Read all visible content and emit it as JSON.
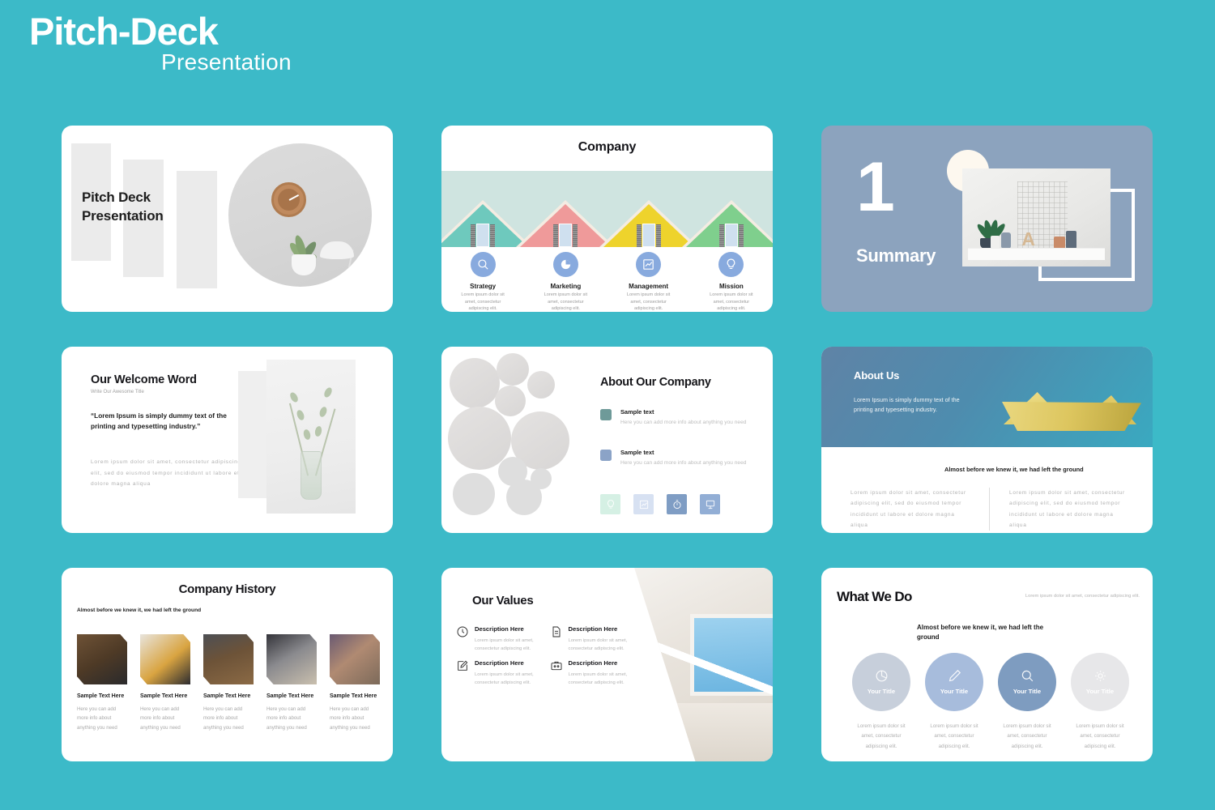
{
  "header": {
    "title": "Pitch-Deck",
    "subtitle": "Presentation"
  },
  "colors": {
    "background_teal": "#3cbac8",
    "slate_blue": "#8ca3be",
    "icon_blue": "#88aade",
    "swatch_teal": "#6e9a99",
    "swatch_blue": "#8ba3c7"
  },
  "slides": {
    "cover": {
      "title_line1": "Pitch Deck",
      "title_line2": "Presentation",
      "photo_alt": "wall-clock-lamp-plant-photo"
    },
    "company": {
      "title": "Company",
      "items": [
        {
          "icon": "search-icon",
          "label": "Strategy",
          "text": "Lorem ipsum dolor sit amet, consectetur adipiscing elit.",
          "roof_color": "#6ec9bd"
        },
        {
          "icon": "pie-chart-icon",
          "label": "Marketing",
          "text": "Lorem ipsum dolor sit amet, consectetur adipiscing elit.",
          "roof_color": "#ef9a9a"
        },
        {
          "icon": "line-chart-icon",
          "label": "Management",
          "text": "Lorem ipsum dolor sit amet, consectetur adipiscing elit.",
          "roof_color": "#eed32c"
        },
        {
          "icon": "lightbulb-icon",
          "label": "Mission",
          "text": "Lorem ipsum dolor sit amet, consectetur adipiscing elit.",
          "roof_color": "#7fcf8d"
        }
      ]
    },
    "summary": {
      "number": "1",
      "label": "Summary",
      "photo_alt": "shelf-decor-plant-grid-photo"
    },
    "welcome": {
      "title": "Our Welcome Word",
      "subtitle": "Write Our Awesome Title",
      "quote": "“Lorem Ipsum is simply dummy text of the printing and typesetting industry.”",
      "body": "Lorem ipsum dolor sit amet, consectetur adipiscing elit, sed do eiusmod tempor incididunt ut labore et dolore magna aliqua",
      "photo_alt": "eucalyptus-vase-photo"
    },
    "about_company": {
      "title": "About Our Company",
      "items": [
        {
          "heading": "Sample text",
          "text": "Here you can add more info about anything you need",
          "swatch": "#6e9a99"
        },
        {
          "heading": "Sample text",
          "text": "Here you can add more info about anything you need",
          "swatch": "#8ba3c7"
        }
      ],
      "tiles": [
        {
          "icon": "lightbulb-icon",
          "color": "#d5f0e4"
        },
        {
          "icon": "line-chart-icon",
          "color": "#d7e1f2"
        },
        {
          "icon": "stopwatch-icon",
          "color": "#7f9dc4"
        },
        {
          "icon": "presentation-icon",
          "color": "#92aed5"
        }
      ]
    },
    "about_us": {
      "title": "About Us",
      "subtitle": "Lorem Ipsum is simply dummy text of the printing and typesetting industry.",
      "kicker": "Almost before we knew it, we had left the ground",
      "columns": [
        "Lorem ipsum dolor sit amet, consectetur adipiscing elit, sed do eiusmod tempor incididunt ut labore et dolore magna aliqua",
        "Lorem ipsum dolor sit amet, consectetur adipiscing elit, sed do eiusmod tempor incididunt ut labore et dolore magna aliqua"
      ],
      "photo_alt": "yellow-origami-paper-boat-photo"
    },
    "history": {
      "title": "Company History",
      "kicker": "Almost before we knew it, we had left the ground",
      "cards": [
        {
          "heading": "Sample Text Here",
          "text": "Here you can add more info about anything you need",
          "photo_alt": "desk-coffee-notebook-photo"
        },
        {
          "heading": "Sample Text Here",
          "text": "Here you can add more info about anything you need",
          "photo_alt": "signing-documents-photo"
        },
        {
          "heading": "Sample Text Here",
          "text": "Here you can add more info about anything you need",
          "photo_alt": "team-meeting-table-photo"
        },
        {
          "heading": "Sample Text Here",
          "text": "Here you can add more info about anything you need",
          "photo_alt": "newspaper-reading-photo"
        },
        {
          "heading": "Sample Text Here",
          "text": "Here you can add more info about anything you need",
          "photo_alt": "hands-building-blocks-photo"
        }
      ]
    },
    "values": {
      "title": "Our Values",
      "items": [
        {
          "icon": "clock-icon",
          "heading": "Description Here",
          "text": "Lorem ipsum dolor sit amet, consectetur adipiscing elit."
        },
        {
          "icon": "document-icon",
          "heading": "Description Here",
          "text": "Lorem ipsum dolor sit amet, consectetur adipiscing elit."
        },
        {
          "icon": "pencil-edit-icon",
          "heading": "Description Here",
          "text": "Lorem ipsum dolor sit amet, consectetur adipiscing elit."
        },
        {
          "icon": "briefcase-icon",
          "heading": "Description Here",
          "text": "Lorem ipsum dolor sit amet, consectetur adipiscing elit."
        }
      ],
      "photo_alt": "interior-window-wood-ceiling-photo"
    },
    "what_we_do": {
      "title": "What We Do",
      "lead": "Lorem ipsum dolor sit amet, consectetur adipiscing elit.",
      "kicker": "Almost before we knew it, we had left the ground",
      "items": [
        {
          "icon": "pie-chart-icon",
          "title": "Your Title",
          "text": "Lorem ipsum dolor sit amet, consectetur adipiscing elit.",
          "color": "#c7cfdb"
        },
        {
          "icon": "pencil-edit-icon",
          "title": "Your Title",
          "text": "Lorem ipsum dolor sit amet, consectetur adipiscing elit.",
          "color": "#a7bcdc"
        },
        {
          "icon": "search-icon",
          "title": "Your Title",
          "text": "Lorem ipsum dolor sit amet, consectetur adipiscing elit.",
          "color": "#7e9cc0"
        },
        {
          "icon": "gear-icon",
          "title": "Your Title",
          "text": "Lorem ipsum dolor sit amet, consectetur adipiscing elit.",
          "color": "#e7e7e9"
        }
      ]
    }
  }
}
